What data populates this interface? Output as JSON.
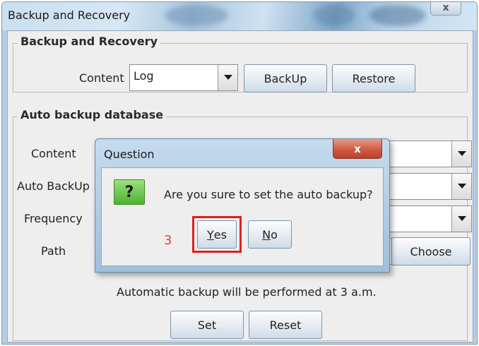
{
  "window": {
    "title": "Backup and Recovery",
    "close_glyph": "x"
  },
  "backup_group": {
    "title": "Backup and Recovery",
    "content_label": "Content",
    "content_value": "Log",
    "backup_button": "BackUp",
    "restore_button": "Restore"
  },
  "auto_group": {
    "title": "Auto backup database",
    "content_label": "Content",
    "auto_backup_label": "Auto BackUp",
    "frequency_label": "Frequency",
    "path_label": "Path",
    "choose_button": "Choose",
    "info_text": "Automatic backup will be performed at 3 a.m.",
    "set_button": "Set",
    "reset_button": "Reset"
  },
  "dialog": {
    "title": "Question",
    "close_glyph": "x",
    "icon_glyph": "?",
    "message": "Are you sure to set the auto backup?",
    "yes_mnemonic": "Y",
    "yes_rest": "es",
    "no_mnemonic": "N",
    "no_rest": "o",
    "step_number": "3"
  },
  "colors": {
    "highlight": "#e02020",
    "step_number": "#d24a3a",
    "question_icon": "#4fb12f"
  },
  "icons": [
    "window-close-icon",
    "dropdown-arrow-icon",
    "question-icon",
    "dialog-close-icon"
  ]
}
